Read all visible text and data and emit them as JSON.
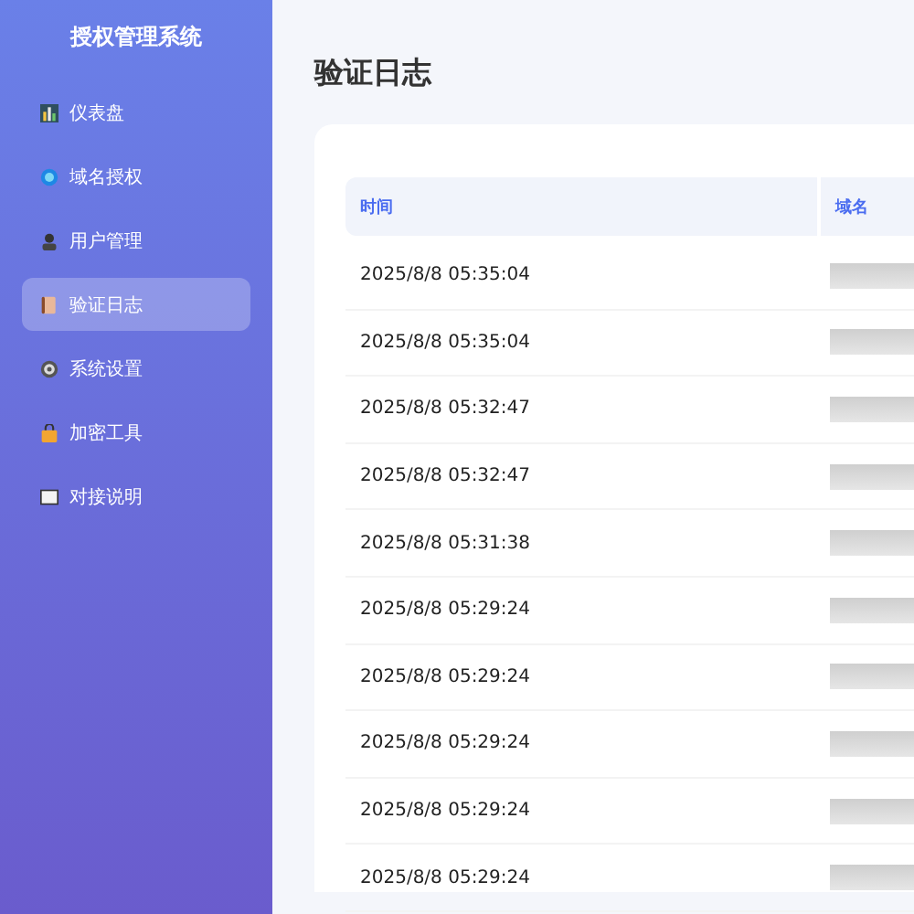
{
  "sidebar": {
    "title": "授权管理系统",
    "items": [
      {
        "label": "仪表盘",
        "selected": false
      },
      {
        "label": "域名授权",
        "selected": false
      },
      {
        "label": "用户管理",
        "selected": false
      },
      {
        "label": "验证日志",
        "selected": true
      },
      {
        "label": "系统设置",
        "selected": false
      },
      {
        "label": "加密工具",
        "selected": false
      },
      {
        "label": "对接说明",
        "selected": false
      }
    ]
  },
  "page_title": "验证日志",
  "table": {
    "columns": [
      "时间",
      "域名"
    ],
    "rows": [
      {
        "time": "2025/8/8 05:35:04"
      },
      {
        "time": "2025/8/8 05:35:04"
      },
      {
        "time": "2025/8/8 05:32:47"
      },
      {
        "time": "2025/8/8 05:32:47"
      },
      {
        "time": "2025/8/8 05:31:38"
      },
      {
        "time": "2025/8/8 05:29:24"
      },
      {
        "time": "2025/8/8 05:29:24"
      },
      {
        "time": "2025/8/8 05:29:24"
      },
      {
        "time": "2025/8/8 05:29:24"
      },
      {
        "time": "2025/8/8 05:29:24"
      }
    ]
  }
}
